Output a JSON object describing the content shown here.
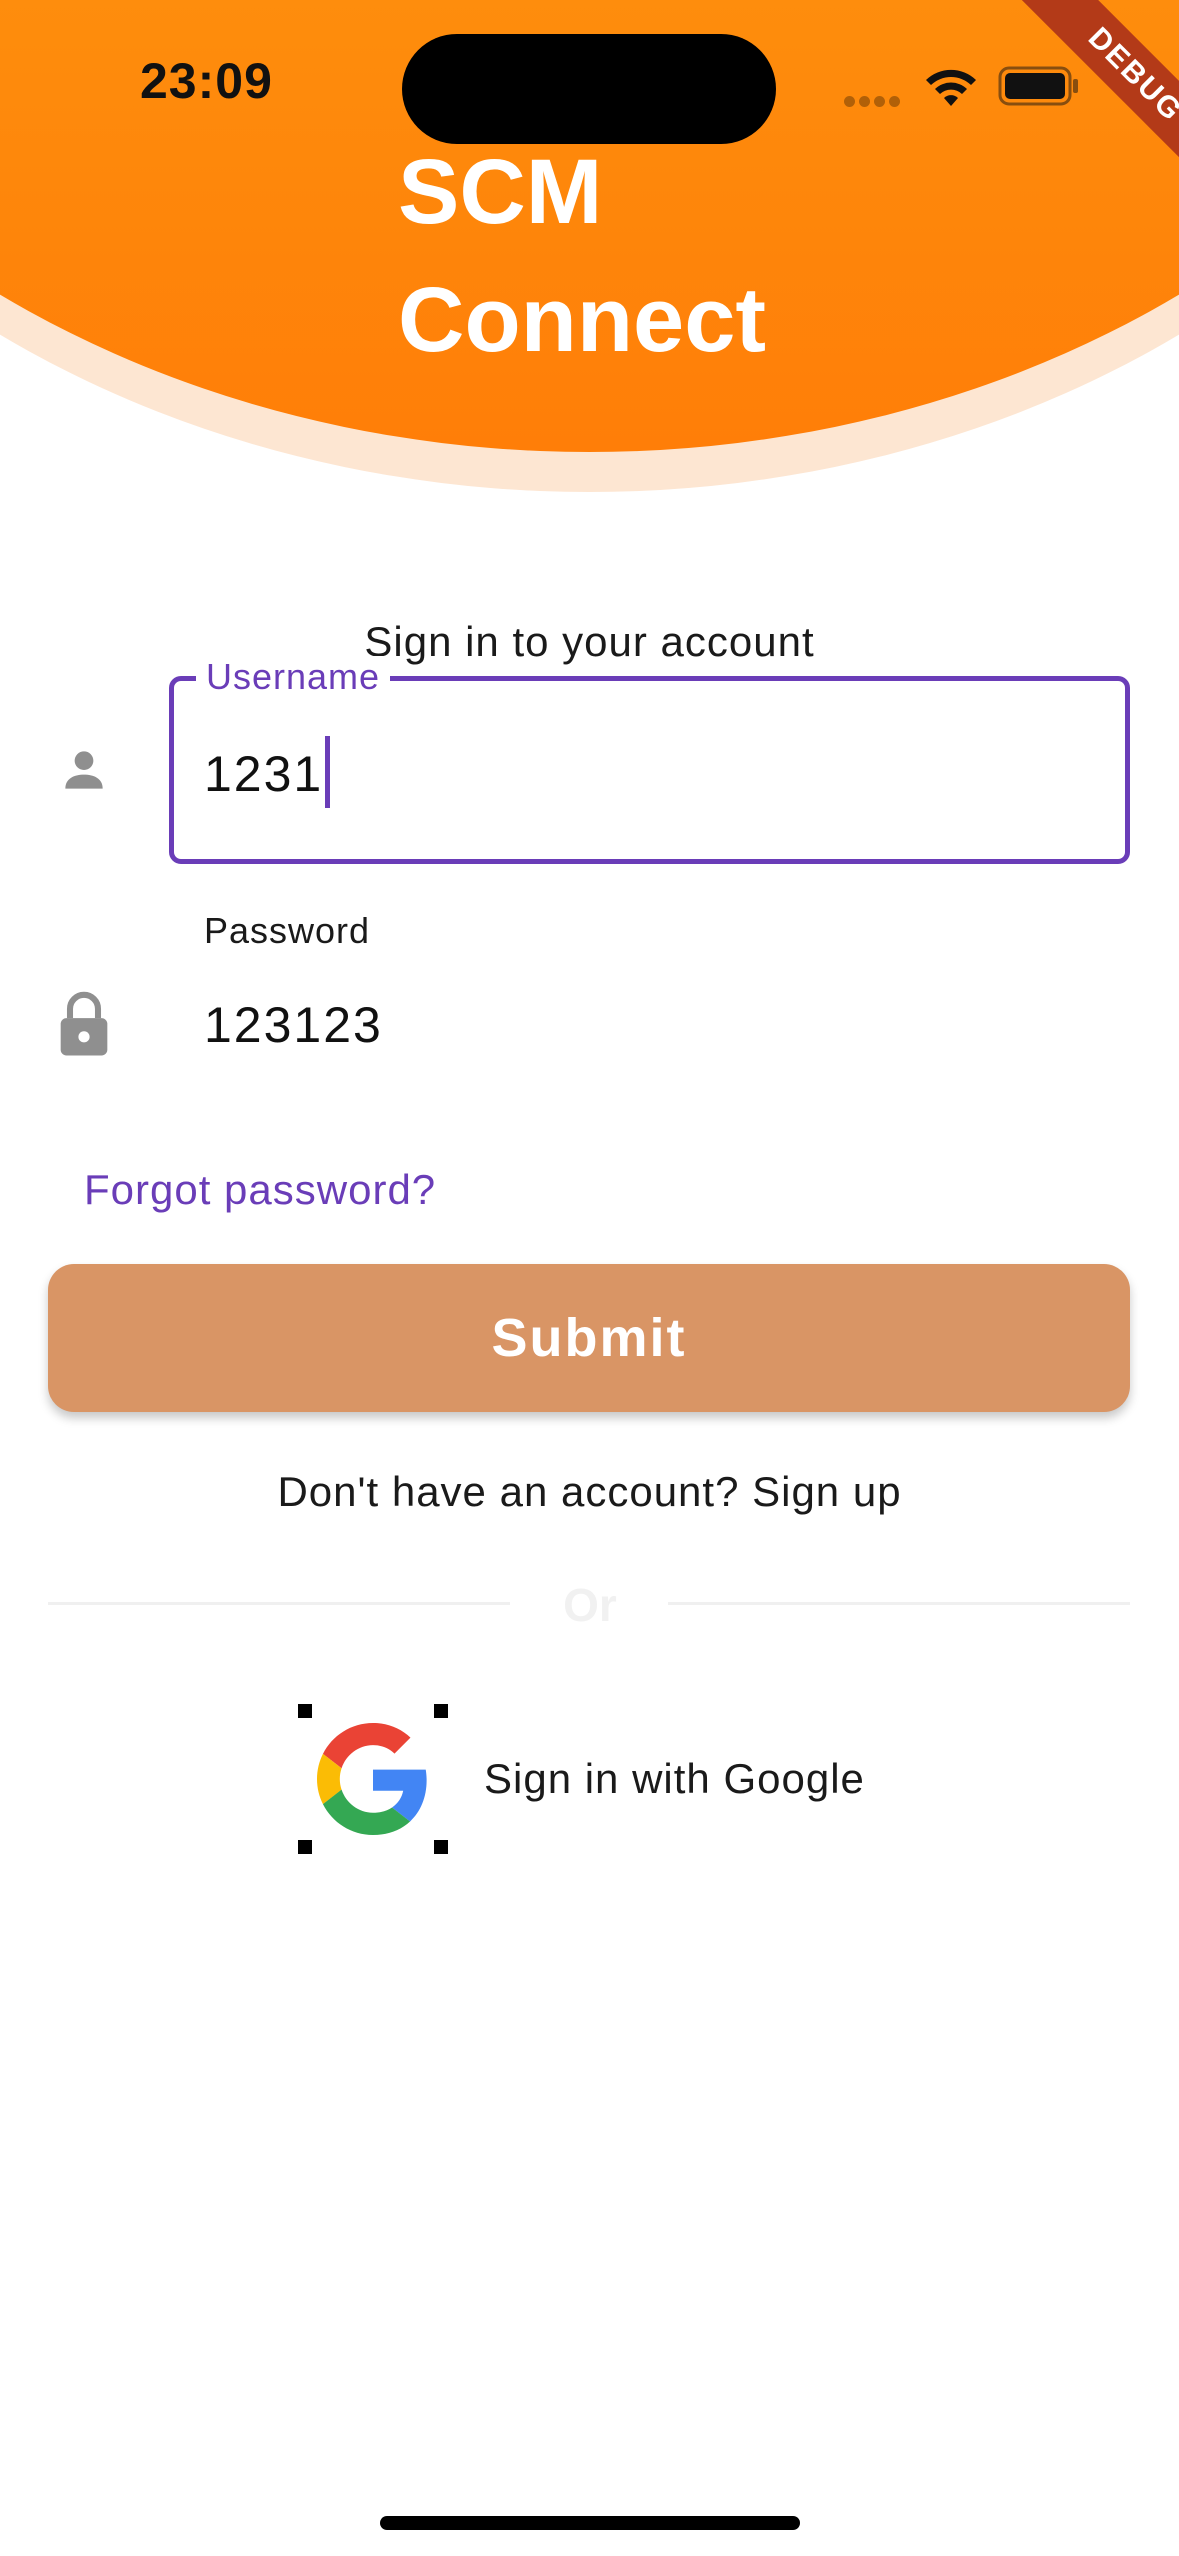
{
  "status_bar": {
    "time": "23:09"
  },
  "debug_banner": "DEBUG",
  "header": {
    "title": "SCM\nConnect"
  },
  "form": {
    "heading": "Sign in to your account",
    "username": {
      "label": "Username",
      "value": "1231"
    },
    "password": {
      "label": "Password",
      "value": "123123"
    },
    "forgot_password": "Forgot password?",
    "submit_label": "Submit",
    "signup_text": "Don't have an account? Sign up",
    "divider_text": "Or",
    "google_signin_label": "Sign in with Google"
  },
  "colors": {
    "accent": "#6a3db8",
    "header_top": "#fbad1e",
    "header_bottom": "#ff7e08",
    "submit_bg": "#d99565"
  },
  "icons": [
    "person-icon",
    "lock-icon",
    "google-icon",
    "wifi-icon",
    "battery-icon"
  ]
}
